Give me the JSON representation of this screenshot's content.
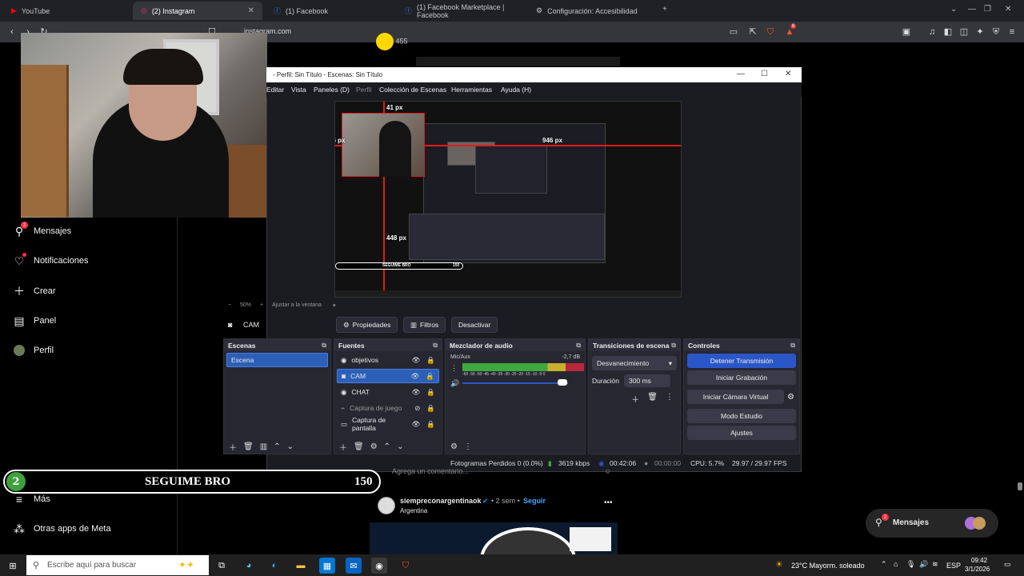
{
  "browser": {
    "tabs": [
      {
        "label": "YouTube"
      },
      {
        "label": "(2) Instagram"
      },
      {
        "label": "(1) Facebook"
      },
      {
        "label": "(1) Facebook Marketplace | Facebook"
      },
      {
        "label": "Configuración: Accesibilidad"
      }
    ],
    "new_tab": "+",
    "url": "instagram.com",
    "brave_badge": "8"
  },
  "instagram": {
    "nav": [
      {
        "label": "Mensajes",
        "badge": "2"
      },
      {
        "label": "Notificaciones"
      },
      {
        "label": "Crear"
      },
      {
        "label": "Panel"
      },
      {
        "label": "Perfil"
      },
      {
        "label": "Más"
      },
      {
        "label": "Otras apps de Meta"
      }
    ],
    "top_count": "455",
    "comment_placeholder": "Agrega un comentario...",
    "post": {
      "user": "siempreconargentinaok",
      "time": "• 2 sem •",
      "follow": "Seguir",
      "location": "Argentina"
    },
    "messages": {
      "label": "Mensajes",
      "badge": "2"
    }
  },
  "stream_overlay": {
    "count": "2",
    "text": "SEGUIME BRO",
    "goal": "150"
  },
  "obs": {
    "title": "- Perfil: Sin Título - Escenas: Sin Título",
    "menu": [
      "Editar",
      "Vista",
      "Paneles (D)",
      "Perfil",
      "Colección de Escenas",
      "Herramientas",
      "Ayuda (H)"
    ],
    "preview_labels": {
      "top": "41 px",
      "left": "26 px",
      "right": "946 px",
      "bottom": "448 px"
    },
    "zoom": {
      "percent": "50%",
      "fit": "Ajustar a la ventana"
    },
    "source_bar": {
      "selected": "CAM",
      "properties": "Propiedades",
      "filters": "Filtros",
      "disable": "Desactivar"
    },
    "docks": {
      "scenes": {
        "title": "Escenas",
        "items": [
          "Escena"
        ]
      },
      "sources": {
        "title": "Fuentes",
        "items": [
          "objetivos",
          "CAM",
          "CHAT",
          "Captura de juego",
          "Captura de pantalla"
        ]
      },
      "mixer": {
        "title": "Mezclador de audio",
        "channel": "Mic/Aux",
        "db": "-2,7 dB",
        "scale": "-60 -55 -50 -45 -40 -35 -30 -25 -20 -15 -10 -5 0"
      },
      "transitions": {
        "title": "Transiciones de escena",
        "type": "Desvanecimiento",
        "duration_label": "Duración",
        "duration": "300 ms"
      },
      "controls": {
        "title": "Controles",
        "buttons": [
          "Detener Transmisión",
          "Iniciar Grabación",
          "Iniciar Cámara Virtual",
          "Modo Estudio",
          "Ajustes"
        ]
      }
    },
    "status": {
      "dropped": "Fotogramas Perdidos 0 (0.0%)",
      "bitrate": "3619 kbps",
      "stream_time": "00:42:06",
      "rec_time": "00:00:00",
      "cpu": "CPU: 5.7%",
      "fps": "29.97 / 29.97 FPS"
    }
  },
  "taskbar": {
    "search_placeholder": "Escribe aquí para buscar",
    "weather": "23°C  Mayorm. soleado",
    "lang": "ESP",
    "time": "09:42",
    "date": "3/1/2026"
  },
  "colors": {
    "obs_bg": "#1b1b22",
    "obs_select": "#2c5fb8",
    "instagram_badge": "#ff3040",
    "overlay_green": "#3ea13e"
  }
}
